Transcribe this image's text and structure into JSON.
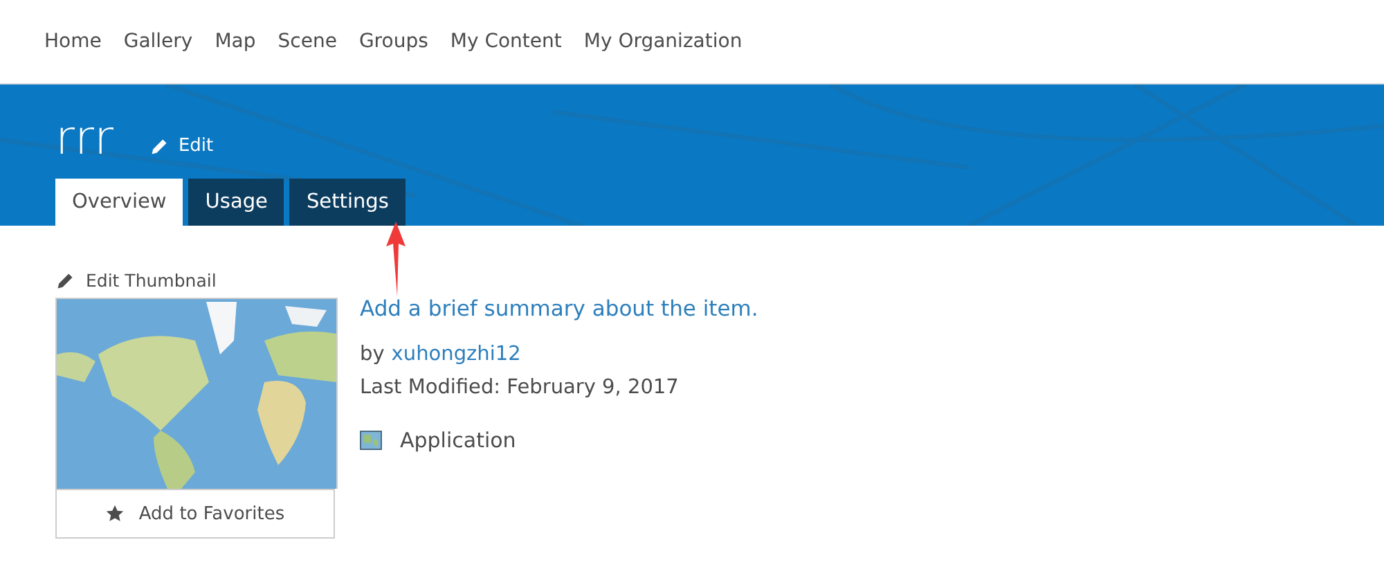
{
  "nav": {
    "items": [
      {
        "label": "Home"
      },
      {
        "label": "Gallery"
      },
      {
        "label": "Map"
      },
      {
        "label": "Scene"
      },
      {
        "label": "Groups"
      },
      {
        "label": "My Content"
      },
      {
        "label": "My Organization"
      }
    ]
  },
  "header": {
    "title": "rrr",
    "edit_label": "Edit"
  },
  "tabs": [
    {
      "label": "Overview",
      "selected": true
    },
    {
      "label": "Usage",
      "selected": false
    },
    {
      "label": "Settings",
      "selected": false
    }
  ],
  "thumbnail": {
    "edit_label": "Edit Thumbnail",
    "kind": "picture",
    "favorite_label": "Add to Favorites"
  },
  "details": {
    "summary": "Add a brief summary about the item.",
    "by_prefix": "by",
    "owner": "xuhongzhi12",
    "modified": "Last Modified: February 9, 2017",
    "type": "Application"
  }
}
